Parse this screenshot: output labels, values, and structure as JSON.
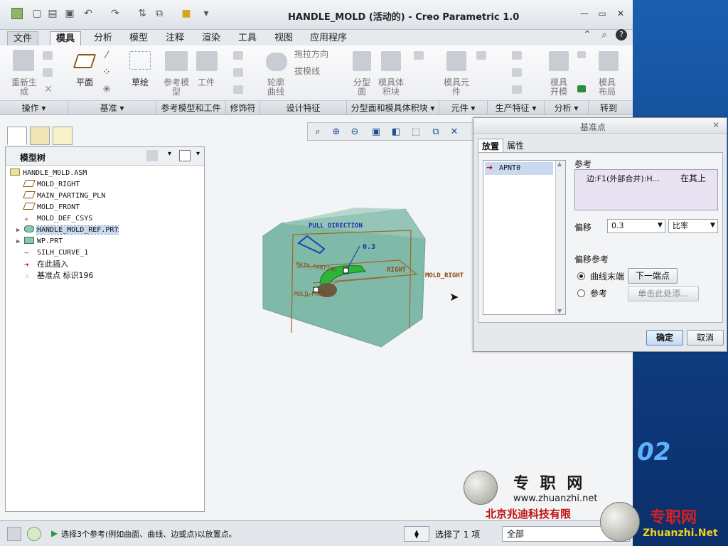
{
  "window": {
    "title": "HANDLE_MOLD (活动的) - Creo Parametric 1.0"
  },
  "tabs": [
    {
      "label": "文件"
    },
    {
      "label": "模具"
    },
    {
      "label": "分析"
    },
    {
      "label": "模型"
    },
    {
      "label": "注释"
    },
    {
      "label": "渲染"
    },
    {
      "label": "工具"
    },
    {
      "label": "视图"
    },
    {
      "label": "应用程序"
    }
  ],
  "ribbon": {
    "regenerate": "重新生\n成",
    "plane": "平面",
    "sketch": "草绘",
    "ref_model": "参考模\n型",
    "workpiece": "工件",
    "silhouette": "轮廓\n曲线",
    "draft_dir": "拖拉方向",
    "draft_check": "拔模线",
    "parting": "分型\n面",
    "mold_volume": "模具体\n积块",
    "mold_comp": "模具元\n件",
    "mold_open": "模具\n开模",
    "mold_layout": "模具\n布局"
  },
  "groups": [
    {
      "label": "操作 ▾"
    },
    {
      "label": "基准 ▾"
    },
    {
      "label": "参考模型和工件"
    },
    {
      "label": "修饰符"
    },
    {
      "label": "设计特征"
    },
    {
      "label": "分型面和模具体积块 ▾"
    },
    {
      "label": "元件 ▾"
    },
    {
      "label": "生产特征 ▾"
    },
    {
      "label": "分析 ▾"
    },
    {
      "label": "转到"
    }
  ],
  "model_tree": {
    "header": "模型树",
    "items": [
      {
        "label": "HANDLE_MOLD.ASM",
        "icon": "assembly-icon"
      },
      {
        "label": "MOLD_RIGHT",
        "icon": "datum-plane-icon"
      },
      {
        "label": "MAIN_PARTING_PLN",
        "icon": "datum-plane-icon"
      },
      {
        "label": "MOLD_FRONT",
        "icon": "datum-plane-icon"
      },
      {
        "label": "MOLD_DEF_CSYS",
        "icon": "csys-icon"
      },
      {
        "label": "HANDLE_MOLD_REF.PRT",
        "icon": "part-icon"
      },
      {
        "label": "WP.PRT",
        "icon": "part-icon"
      },
      {
        "label": "SILH_CURVE_1",
        "icon": "curve-icon"
      },
      {
        "label": "在此插入",
        "icon": "insert-arrow-icon"
      },
      {
        "label": "基准点 标识196",
        "icon": "datum-point-icon"
      }
    ]
  },
  "graphics": {
    "pull_direction": "PULL DIRECTION",
    "offset_label": "0.3",
    "mold_right": "MOLD_RIGHT",
    "right_label": "RIGHT",
    "main_parting": "MAIN_PARTING",
    "mold_front": "MOLD_FRONT"
  },
  "dialog": {
    "title": "基准点",
    "tab_placement": "放置",
    "tab_properties": "属性",
    "list_item": "APNT0",
    "ref_label": "参考",
    "ref_value": "边:F1(外部合并):H...",
    "ref_constraint": "在其上",
    "offset_label": "偏移",
    "offset_value": "0.3",
    "offset_type": "比率",
    "offset_ref_label": "偏移参考",
    "radio_curve_end": "曲线末端",
    "next_endpoint": "下一端点",
    "radio_reference": "参考",
    "click_add": "单击此处添...",
    "ok": "确定",
    "cancel": "取消"
  },
  "status": {
    "message": "选择3个参考(例如曲面、曲线、边或点)以放置点。",
    "selected": "选择了 1 项",
    "filter": "全部"
  },
  "watermark": {
    "brand": "专 职 网",
    "url": "www.zhuanzhi.net",
    "company": "北京兆迪科技有限",
    "brand2": "专职网",
    "url2": "Zhuanzhi.Net",
    "desk_number": "02"
  },
  "colors": {
    "accent": "#1c5fb0",
    "model_fill": "#7fb9a8",
    "model_edge": "#a0662b",
    "highlight": "#2fb43a"
  }
}
